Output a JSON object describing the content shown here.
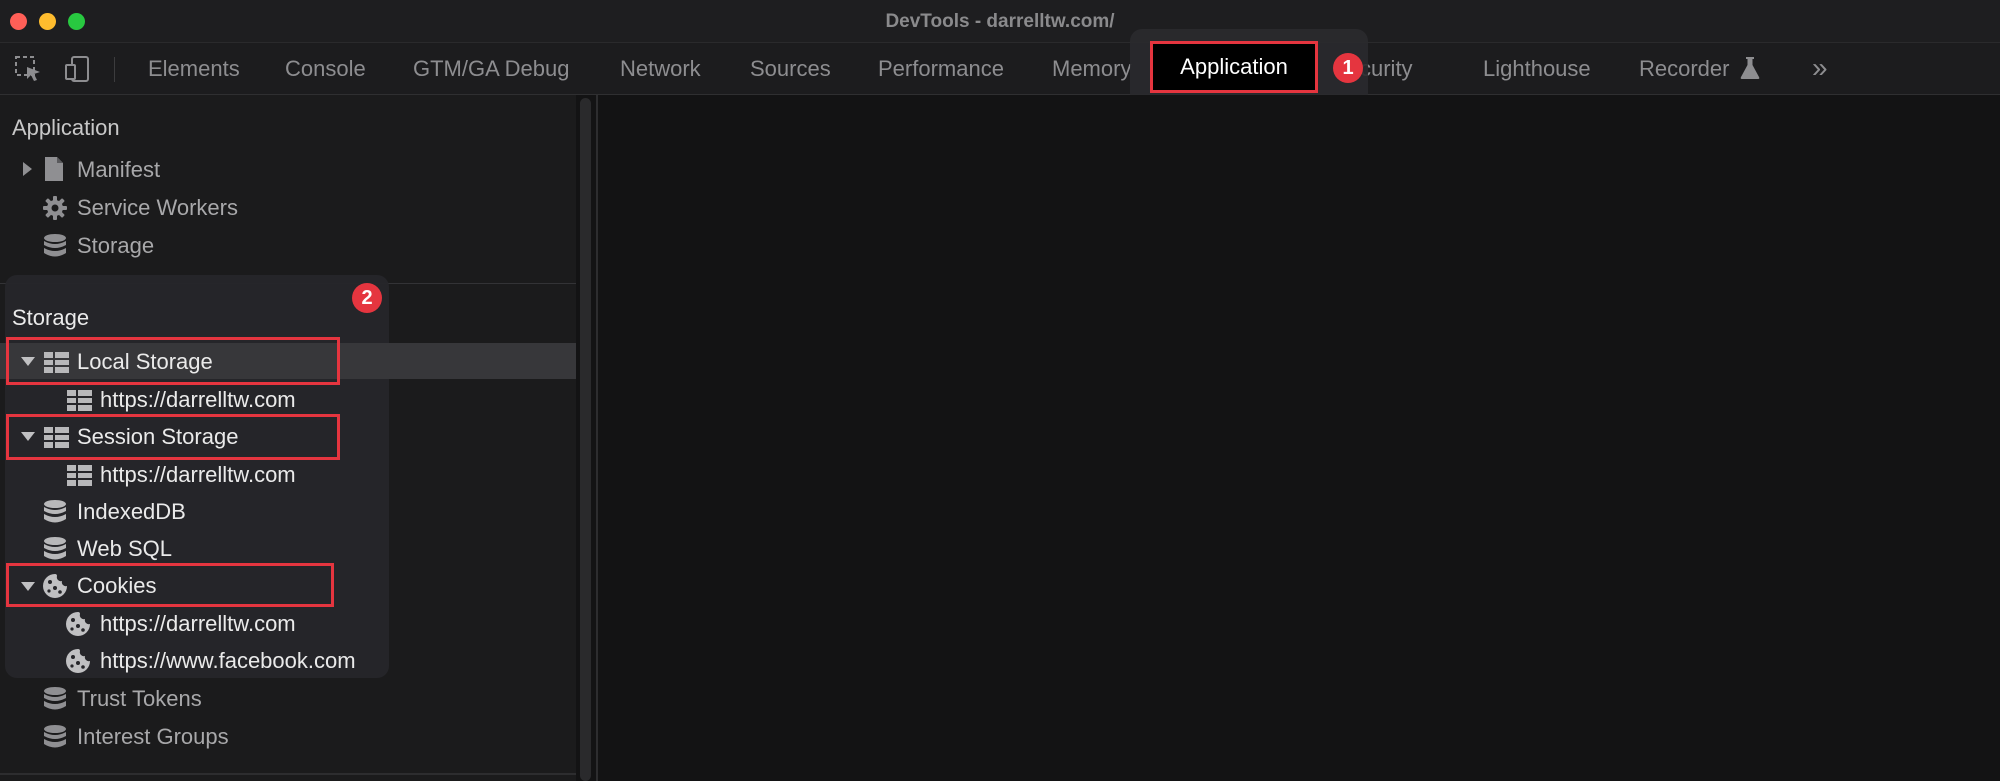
{
  "window": {
    "title": "DevTools - darrelltw.com/"
  },
  "tabs": [
    "Elements",
    "Console",
    "GTM/GA Debug",
    "Network",
    "Sources",
    "Performance",
    "Memory",
    "Application",
    "Security",
    "Lighthouse",
    "Recorder"
  ],
  "tab_partial": {
    "memory": "Memory",
    "security": "curity"
  },
  "more_tabs": "»",
  "badges": {
    "one": "1",
    "two": "2"
  },
  "sidebar": {
    "application": {
      "heading": "Application",
      "items": [
        "Manifest",
        "Service Workers",
        "Storage"
      ]
    },
    "storage": {
      "heading": "Storage",
      "local_storage": "Local Storage",
      "local_origin": "https://darrelltw.com",
      "session_storage": "Session Storage",
      "session_origin": "https://darrelltw.com",
      "indexeddb": "IndexedDB",
      "websql": "Web SQL",
      "cookies": "Cookies",
      "cookie_origins": [
        "https://darrelltw.com",
        "https://www.facebook.com"
      ],
      "trust_tokens": "Trust Tokens",
      "interest_groups": "Interest Groups"
    }
  },
  "colors": {
    "highlight": "#e5353f",
    "background": "#131314",
    "sidebar": "#1b1b1c"
  }
}
